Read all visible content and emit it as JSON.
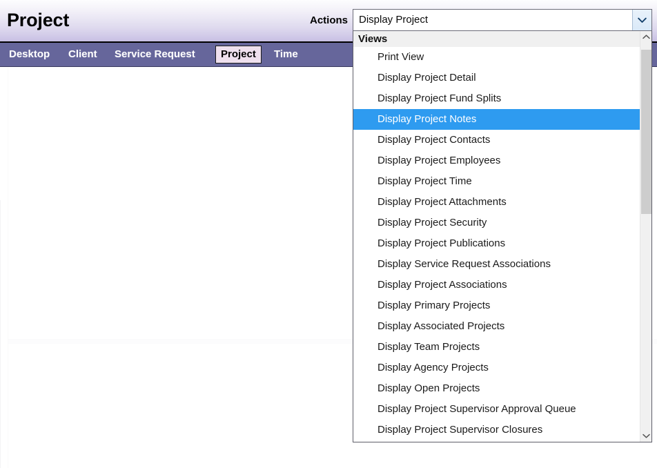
{
  "header": {
    "title": "Project",
    "actions_label": "Actions"
  },
  "nav": {
    "items": [
      {
        "label": "Desktop",
        "active": false
      },
      {
        "label": "Client",
        "active": false
      },
      {
        "label": "Service Request",
        "active": false
      },
      {
        "label": "Project",
        "active": true
      },
      {
        "label": "Time",
        "active": false
      }
    ]
  },
  "views_select": {
    "selected_value": "Display Project",
    "expanded": true,
    "group_label": "Views",
    "selected_option": "Display Project Notes",
    "options": [
      "Print View",
      "Display Project Detail",
      "Display Project Fund Splits",
      "Display Project Notes",
      "Display Project Contacts",
      "Display Project Employees",
      "Display Project Time",
      "Display Project Attachments",
      "Display Project Security",
      "Display Project Publications",
      "Display Service Request Associations",
      "Display Project Associations",
      "Display Primary Projects",
      "Display Associated Projects",
      "Display Team Projects",
      "Display Agency Projects",
      "Display Open Projects",
      "Display Project Supervisor Approval Queue",
      "Display Project Supervisor Closures"
    ]
  },
  "colors": {
    "nav_bar": "#66669b",
    "header_gradient_top": "#fdfdfe",
    "header_gradient_bottom": "#c8c0e4",
    "active_tab_bg": "#efe0ee",
    "selection_highlight": "#2e9bf0",
    "optgroup_bg": "#f0f0f0",
    "scrollbar_track": "#f0f0f0",
    "scrollbar_thumb": "#cdcdcd"
  }
}
